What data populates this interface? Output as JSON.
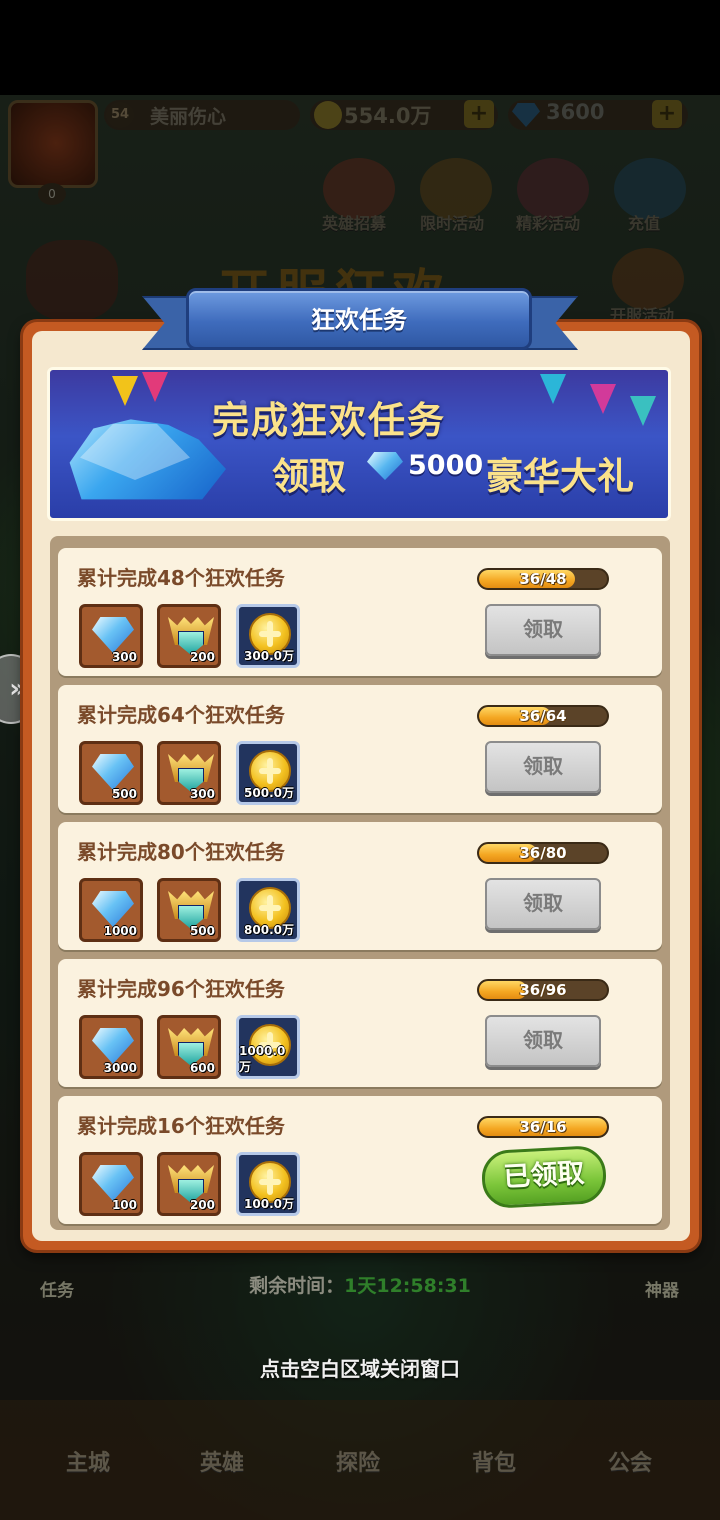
{
  "player": {
    "level": "54",
    "name": "美丽伤心",
    "gold": "554.0万",
    "gems": "3600",
    "avatar_badge": "0"
  },
  "top_activities": [
    "英雄招募",
    "限时活动",
    "精彩活动",
    "充值"
  ],
  "event_side_label": "开服活动",
  "event_title_art": "开服狂欢",
  "side_labels": {
    "task": "任务",
    "artifact": "神器"
  },
  "modal": {
    "title": "狂欢任务",
    "banner": {
      "line1": "完成狂欢任务",
      "line2_prefix": "领取",
      "amount": "5000",
      "line2_suffix": "豪华大礼"
    },
    "tasks": [
      {
        "title": "累计完成48个狂欢任务",
        "progress_text": "36/48",
        "progress": 0.75,
        "rewards": [
          "300",
          "200",
          "300.0万"
        ],
        "button": "领取",
        "claimed": false
      },
      {
        "title": "累计完成64个狂欢任务",
        "progress_text": "36/64",
        "progress": 0.5625,
        "rewards": [
          "500",
          "300",
          "500.0万"
        ],
        "button": "领取",
        "claimed": false
      },
      {
        "title": "累计完成80个狂欢任务",
        "progress_text": "36/80",
        "progress": 0.45,
        "rewards": [
          "1000",
          "500",
          "800.0万"
        ],
        "button": "领取",
        "claimed": false
      },
      {
        "title": "累计完成96个狂欢任务",
        "progress_text": "36/96",
        "progress": 0.375,
        "rewards": [
          "3000",
          "600",
          "1000.0万"
        ],
        "button": "领取",
        "claimed": false
      },
      {
        "title": "累计完成16个狂欢任务",
        "progress_text": "36/16",
        "progress": 1.0,
        "rewards": [
          "100",
          "200",
          "100.0万"
        ],
        "button": "已领取",
        "claimed": true
      }
    ]
  },
  "timer": {
    "label": "剩余时间：",
    "value": "1天12:58:31"
  },
  "close_hint": "点击空白区域关闭窗口",
  "bottom_nav": [
    "主城",
    "英雄",
    "探险",
    "背包",
    "公会"
  ],
  "colors": {
    "panel_frame": "#c45a22",
    "ribbon": "#3f6cbd",
    "progress_fill": "#f4a621",
    "claimed_green": "#7cc63a"
  }
}
